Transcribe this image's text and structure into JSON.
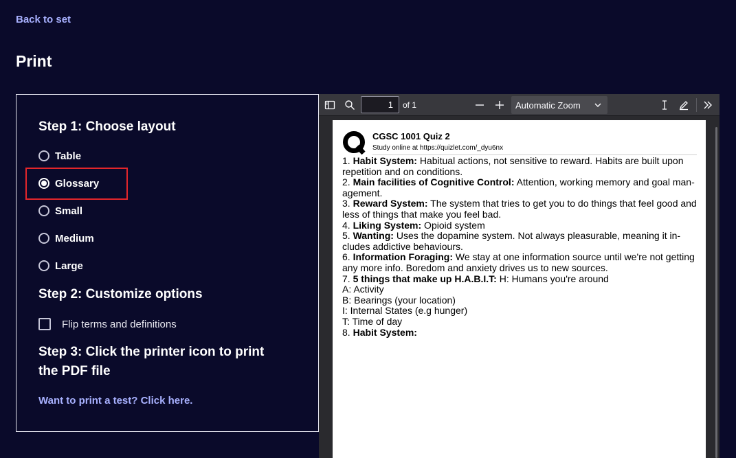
{
  "header": {
    "back_link": "Back to set",
    "title": "Print"
  },
  "options": {
    "step1_heading": "Step 1: Choose layout",
    "layouts": [
      {
        "label": "Table",
        "checked": false
      },
      {
        "label": "Glossary",
        "checked": true
      },
      {
        "label": "Small",
        "checked": false
      },
      {
        "label": "Medium",
        "checked": false
      },
      {
        "label": "Large",
        "checked": false
      }
    ],
    "step2_heading": "Step 2: Customize options",
    "flip_label": "Flip terms and definitions",
    "step3_line1": "Step 3: Click the printer icon to print",
    "step3_line2": "the PDF file",
    "test_link": "Want to print a test? Click here."
  },
  "viewer": {
    "page_number": "1",
    "page_of": "of 1",
    "zoom": "Automatic Zoom",
    "icons": [
      "sidebar-toggle-icon",
      "search-icon",
      "zoom-out-icon",
      "zoom-in-icon",
      "text-cursor-icon",
      "pen-icon",
      "more-tools-icon"
    ]
  },
  "pdf": {
    "set_title": "CGSC 1001 Quiz 2",
    "set_subtitle": "Study online at https://quizlet.com/_dyu6nx",
    "lines": [
      {
        "term": "1. ",
        "bold": "Habit System:",
        "rest": " Habitual actions, not sensitive to reward. Habits are built upon"
      },
      {
        "term": "",
        "bold": "",
        "rest": "repetition and on conditions."
      },
      {
        "term": "2. ",
        "bold": "Main facilities of Cognitive Control:",
        "rest": " Attention, working memory and goal man-"
      },
      {
        "term": "",
        "bold": "",
        "rest": "agement."
      },
      {
        "term": "3. ",
        "bold": "Reward System:",
        "rest": " The system that tries to get you to do things that feel good and"
      },
      {
        "term": "",
        "bold": "",
        "rest": "less of things that make you feel bad."
      },
      {
        "term": "4. ",
        "bold": "Liking System:",
        "rest": " Opioid system"
      },
      {
        "term": "5. ",
        "bold": "Wanting:",
        "rest": " Uses the dopamine system. Not always pleasurable, meaning it in-"
      },
      {
        "term": "",
        "bold": "",
        "rest": "cludes addictive behaviours."
      },
      {
        "term": "6. ",
        "bold": "Information Foraging:",
        "rest": " We stay at one information source until we're not getting"
      },
      {
        "term": "",
        "bold": "",
        "rest": "any more info. Boredom and anxiety drives us to new sources."
      },
      {
        "term": "7. ",
        "bold": "5 things that make up H.A.B.I.T:",
        "rest": " H: Humans you're around"
      },
      {
        "term": "",
        "bold": "",
        "rest": "A: Activity"
      },
      {
        "term": "",
        "bold": "",
        "rest": "B: Bearings (your location)"
      },
      {
        "term": "",
        "bold": "",
        "rest": "I: Internal States (e.g hunger)"
      },
      {
        "term": "",
        "bold": "",
        "rest": "T: Time of day"
      },
      {
        "term": "8. ",
        "bold": "Habit System:",
        "rest": ""
      }
    ]
  },
  "colors": {
    "background": "#0a0a2a",
    "link": "#a8b1ff",
    "highlight": "#e3262b"
  }
}
